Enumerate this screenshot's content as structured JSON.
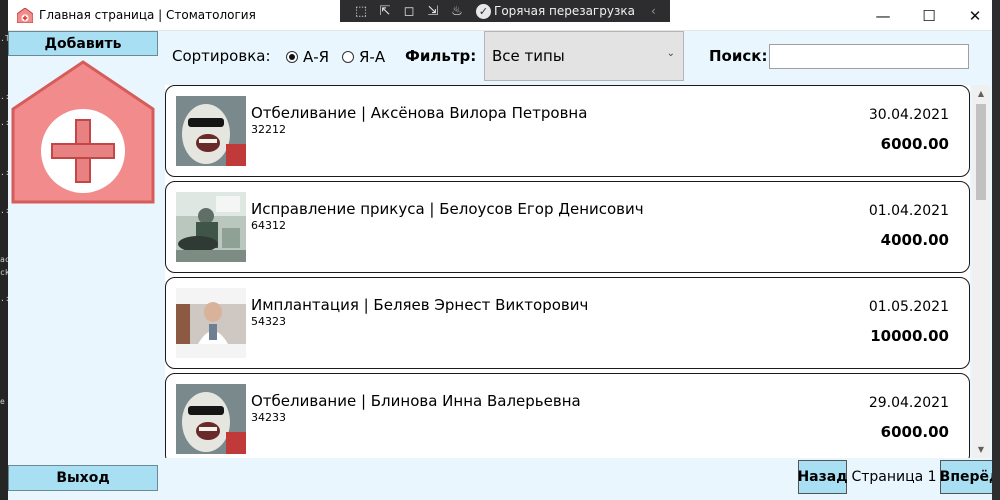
{
  "window": {
    "title": "Главная страница | Стоматология",
    "minimize_glyph": "—",
    "maximize_glyph": "☐",
    "close_glyph": "✕"
  },
  "debug_toolbar": {
    "hot_reload_label": "Горячая перезагрузка",
    "icons": [
      "select-element-icon",
      "display-layout-adorners-icon",
      "track-focus-icon",
      "element-picker-icon",
      "hot-reload-icon"
    ]
  },
  "sidebar": {
    "add_label": "Добавить",
    "exit_label": "Выход"
  },
  "toolbar": {
    "sort_label": "Сортировка:",
    "sort_options": [
      {
        "label": "А-Я",
        "checked": true
      },
      {
        "label": "Я-А",
        "checked": false
      }
    ],
    "filter_label": "Фильтр:",
    "filter_value": "Все типы",
    "search_label": "Поиск:",
    "search_value": ""
  },
  "services": [
    {
      "title": "Отбеливание | Аксёнова Вилора Петровна",
      "code": "32212",
      "date": "30.04.2021",
      "price": "6000.00",
      "image": "whitening-photo"
    },
    {
      "title": "Исправление прикуса | Белоусов Егор Денисович",
      "code": "64312",
      "date": "01.04.2021",
      "price": "4000.00",
      "image": "dentist-office-photo"
    },
    {
      "title": "Имплантация | Беляев Эрнест Викторович",
      "code": "54323",
      "date": "01.05.2021",
      "price": "10000.00",
      "image": "doctor-photo"
    },
    {
      "title": "Отбеливание | Блинова Инна Валерьевна",
      "code": "34233",
      "date": "29.04.2021",
      "price": "6000.00",
      "image": "whitening-photo"
    }
  ],
  "pager": {
    "back_label": "Назад",
    "page_label": "Страница 1",
    "next_label": "Вперёд"
  },
  "colors": {
    "button_bg": "#a8dff3",
    "panel_bg": "#eaf6fd",
    "logo_red": "#f28b8b"
  }
}
